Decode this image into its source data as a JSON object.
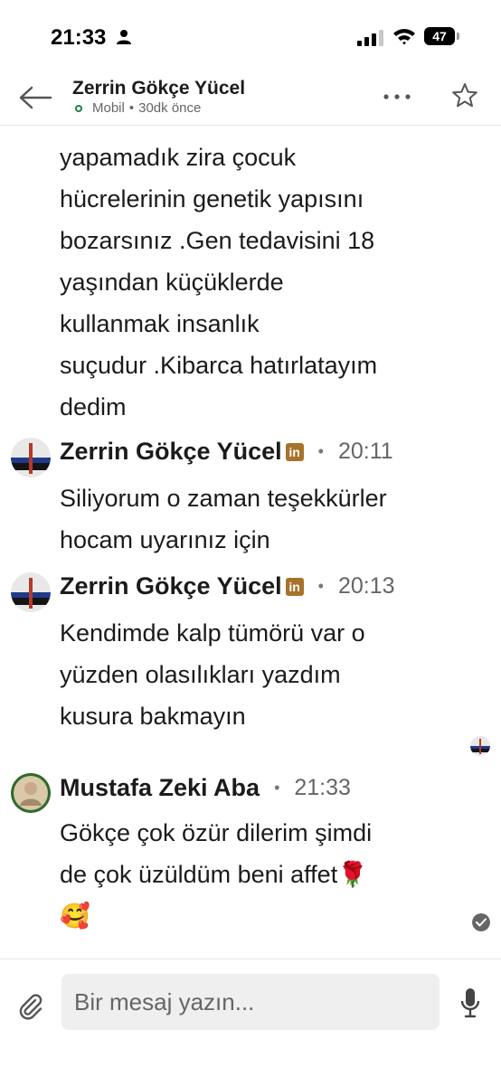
{
  "status_bar": {
    "time": "21:33",
    "battery": "47"
  },
  "header": {
    "name": "Zerrin Gökçe Yücel",
    "status": "Mobil",
    "separator": "•",
    "last_seen": "30dk önce"
  },
  "earlier_message": {
    "lines": [
      "yapamadık zira çocuk",
      "hücrelerinin genetik yapısını",
      "bozarsınız .Gen tedavisini 18",
      "yaşından küçüklerde",
      "kullanmak insanlık",
      "suçudur .Kibarca hatırlatayım",
      "dedim"
    ]
  },
  "messages": [
    {
      "sender": "Zerrin Gökçe Yücel",
      "badge": "in",
      "separator": "•",
      "time": "20:11",
      "lines": [
        "Siliyorum o zaman teşekkürler",
        "hocam uyarınız için"
      ]
    },
    {
      "sender": "Zerrin Gökçe Yücel",
      "badge": "in",
      "separator": "•",
      "time": "20:13",
      "lines": [
        "Kendimde kalp tümörü var o",
        "yüzden olasılıkları yazdım",
        "kusura bakmayın"
      ]
    },
    {
      "sender": "Mustafa Zeki Aba",
      "separator": "•",
      "time": "21:33",
      "lines": [
        "Gökçe çok özür dilerim şimdi",
        "de çok üzüldüm beni affet🌹",
        "🥰"
      ]
    }
  ],
  "composer": {
    "placeholder": "Bir mesaj yazın..."
  }
}
